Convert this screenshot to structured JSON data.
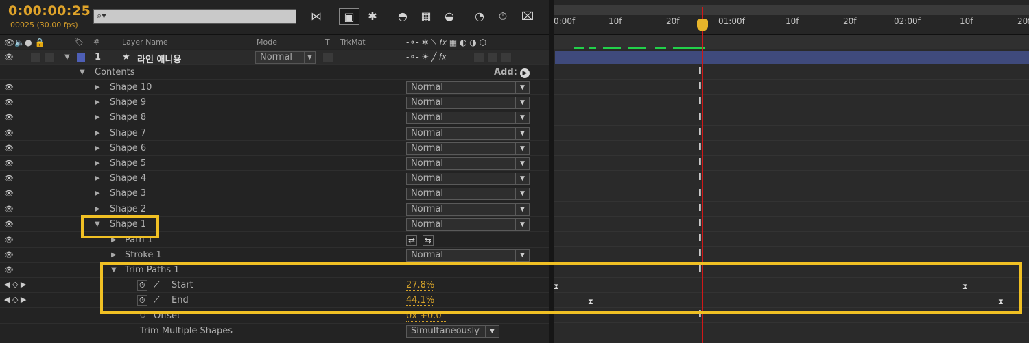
{
  "header": {
    "timecode": "0:00:00:25",
    "fps_line": "00025 (30.00 fps)",
    "search_icon": "magnifier-icon"
  },
  "columns": {
    "num": "#",
    "layer_name": "Layer Name",
    "mode": "Mode",
    "t": "T",
    "trkmat": "TrkMat"
  },
  "layer": {
    "number": "1",
    "name": "라인 애니용",
    "mode": "Normal",
    "label_color": "#4e5fb6"
  },
  "contents": {
    "label": "Contents",
    "add_label": "Add:"
  },
  "shapes": [
    {
      "name": "Shape 10",
      "mode": "Normal"
    },
    {
      "name": "Shape 9",
      "mode": "Normal"
    },
    {
      "name": "Shape 8",
      "mode": "Normal"
    },
    {
      "name": "Shape 7",
      "mode": "Normal"
    },
    {
      "name": "Shape 6",
      "mode": "Normal"
    },
    {
      "name": "Shape 5",
      "mode": "Normal"
    },
    {
      "name": "Shape 4",
      "mode": "Normal"
    },
    {
      "name": "Shape 3",
      "mode": "Normal"
    },
    {
      "name": "Shape 2",
      "mode": "Normal"
    },
    {
      "name": "Shape 1",
      "mode": "Normal"
    }
  ],
  "shape1_children": {
    "path": "Path 1",
    "stroke": "Stroke 1",
    "stroke_mode": "Normal",
    "trim": "Trim Paths 1",
    "start_label": "Start",
    "start_value": "27.8%",
    "end_label": "End",
    "end_value": "44.1%",
    "offset_label": "Offset",
    "offset_value": "0x +0.0°",
    "multi_label": "Trim Multiple Shapes",
    "multi_value": "Simultaneously"
  },
  "timeline": {
    "ticks": [
      "0:00f",
      "10f",
      "20f",
      "01:00f",
      "10f",
      "20f",
      "02:00f",
      "10f",
      "20f"
    ]
  },
  "colors": {
    "accent": "#e0a42a",
    "highlight": "#f0c024",
    "playhead": "#d01818",
    "layer_bar": "#3f4a7c",
    "work_area": "#22d14a"
  }
}
